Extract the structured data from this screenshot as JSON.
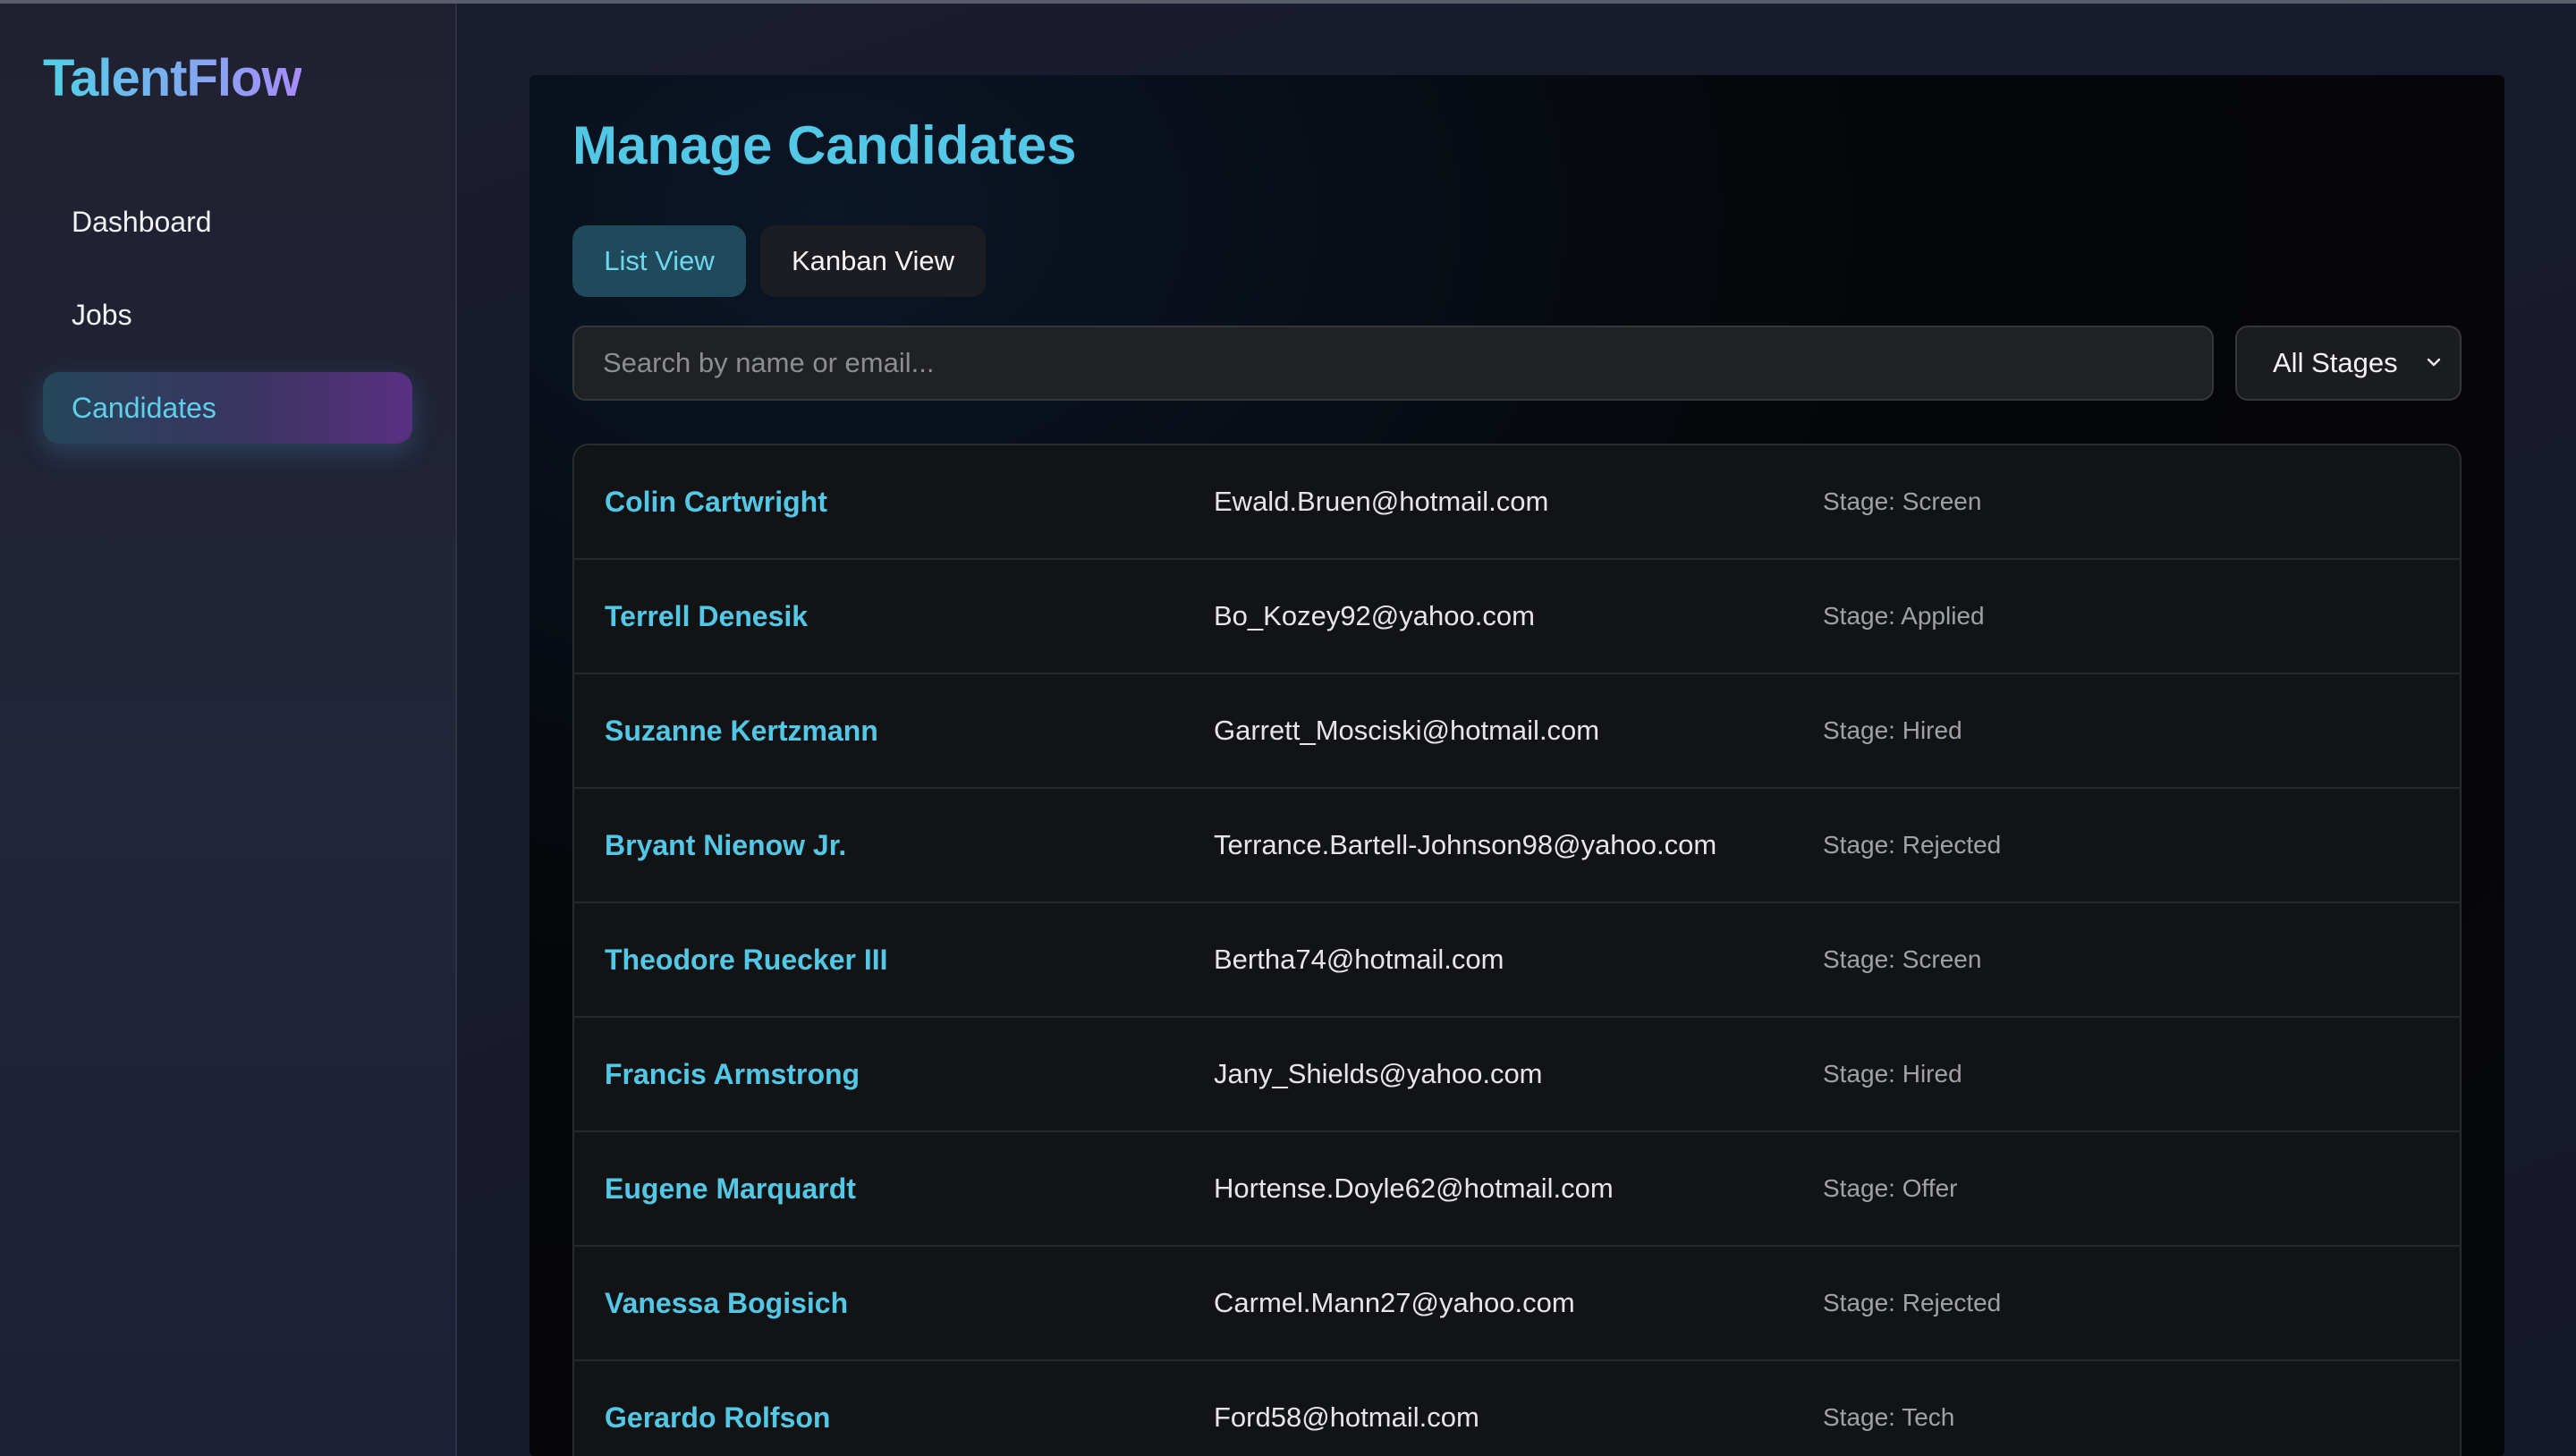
{
  "app": {
    "brand": "TalentFlow"
  },
  "sidebar": {
    "items": [
      {
        "label": "Dashboard",
        "active": false
      },
      {
        "label": "Jobs",
        "active": false
      },
      {
        "label": "Candidates",
        "active": true
      }
    ]
  },
  "main": {
    "title": "Manage Candidates",
    "tabs": [
      {
        "label": "List View",
        "active": true
      },
      {
        "label": "Kanban View",
        "active": false
      }
    ],
    "search": {
      "placeholder": "Search by name or email...",
      "value": ""
    },
    "stage_filter": {
      "selected": "All Stages"
    },
    "candidates": [
      {
        "name": "Colin Cartwright",
        "email": "Ewald.Bruen@hotmail.com",
        "stage": "Stage: Screen"
      },
      {
        "name": "Terrell Denesik",
        "email": "Bo_Kozey92@yahoo.com",
        "stage": "Stage: Applied"
      },
      {
        "name": "Suzanne Kertzmann",
        "email": "Garrett_Mosciski@hotmail.com",
        "stage": "Stage: Hired"
      },
      {
        "name": "Bryant Nienow Jr.",
        "email": "Terrance.Bartell-Johnson98@yahoo.com",
        "stage": "Stage: Rejected"
      },
      {
        "name": "Theodore Ruecker III",
        "email": "Bertha74@hotmail.com",
        "stage": "Stage: Screen"
      },
      {
        "name": "Francis Armstrong",
        "email": "Jany_Shields@yahoo.com",
        "stage": "Stage: Hired"
      },
      {
        "name": "Eugene Marquardt",
        "email": "Hortense.Doyle62@hotmail.com",
        "stage": "Stage: Offer"
      },
      {
        "name": "Vanessa Bogisich",
        "email": "Carmel.Mann27@yahoo.com",
        "stage": "Stage: Rejected"
      },
      {
        "name": "Gerardo Rolfson",
        "email": "Ford58@hotmail.com",
        "stage": "Stage: Tech"
      }
    ]
  },
  "colors": {
    "accent": "#52c8e6",
    "background": "#171a2b",
    "active_tab": "#1f4a5c",
    "brand_gradient_start": "#4fd1e6",
    "brand_gradient_end": "#a78bfa"
  },
  "icons": {
    "select_arrow": "chevron-down-icon"
  }
}
